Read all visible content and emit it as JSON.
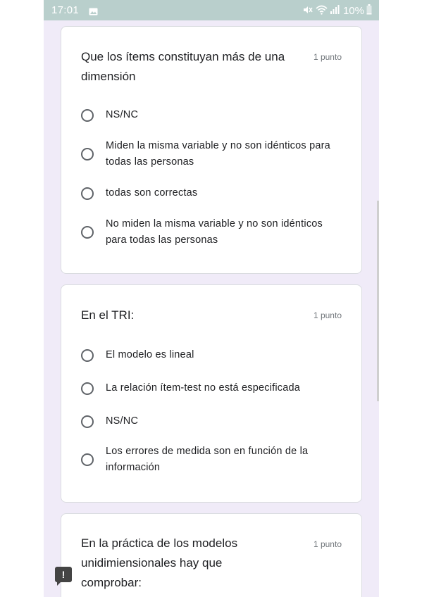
{
  "status_bar": {
    "time": "17:01",
    "battery": "10%",
    "icons": [
      "gallery-icon",
      "mute-icon",
      "wifi-icon",
      "signal-icon",
      "battery-icon"
    ]
  },
  "questions": [
    {
      "title": "Que los ítems constituyan más de una dimensión",
      "points": "1 punto",
      "options": [
        "NS/NC",
        "Miden la misma variable y no son idénticos para todas las personas",
        "todas son correctas",
        "No miden la misma variable y no son idénticos para todas las personas"
      ]
    },
    {
      "title": "En el TRI:",
      "points": "1 punto",
      "options": [
        "El modelo es lineal",
        "La relación ítem-test no está especificada",
        "NS/NC",
        "Los errores de medida son en función de la información"
      ]
    },
    {
      "title": "En la práctica de los modelos unidimiensionales hay que comprobar:",
      "points": "1 punto",
      "options": []
    }
  ],
  "feedback": {
    "icon": "feedback-icon",
    "glyph": "!"
  },
  "colors": {
    "status_bar": "#b9cfcc",
    "page_background": "#f0ebf8",
    "radio_border": "#5f6368",
    "text": "#202124",
    "points_text": "#70757a"
  }
}
